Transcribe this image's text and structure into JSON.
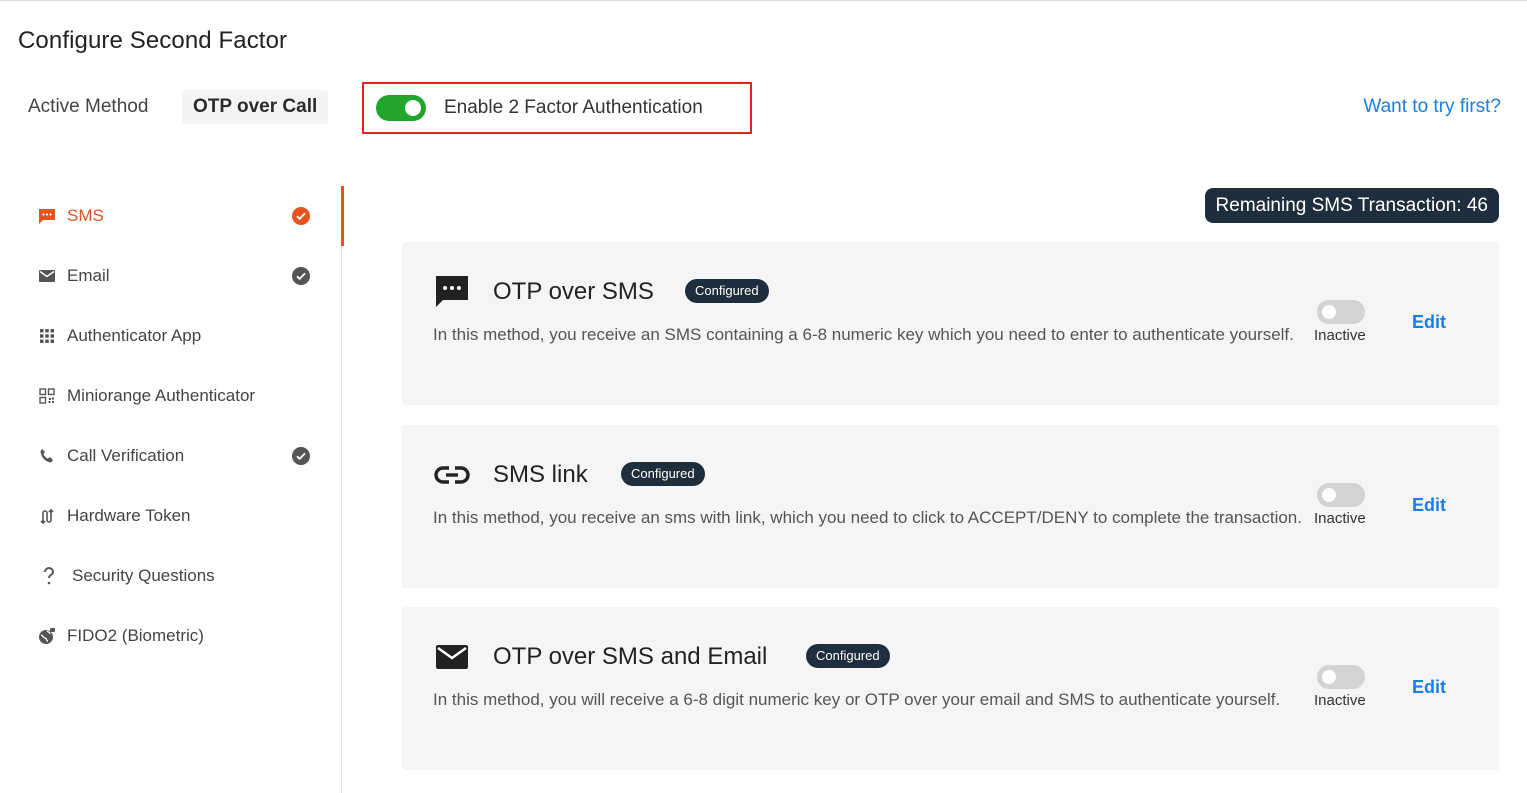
{
  "page": {
    "title": "Configure Second Factor"
  },
  "header": {
    "active_method_label": "Active Method",
    "active_method_value": "OTP over Call",
    "enable_2fa_label": "Enable 2 Factor Authentication",
    "enable_2fa_on": true,
    "try_link": "Want to try first?"
  },
  "colors": {
    "accent": "#e5541f",
    "toggle_on": "#22a52d",
    "link": "#1a7fe0",
    "badge_bg": "#1f2e3d",
    "highlight_border": "#e2231a"
  },
  "sidebar": {
    "items": [
      {
        "label": "SMS",
        "icon": "sms-icon",
        "configured": true,
        "active": true
      },
      {
        "label": "Email",
        "icon": "mail-icon",
        "configured": true,
        "active": false
      },
      {
        "label": "Authenticator App",
        "icon": "grid-icon",
        "configured": false,
        "active": false
      },
      {
        "label": "Miniorange Authenticator",
        "icon": "qr-code-icon",
        "configured": false,
        "active": false
      },
      {
        "label": "Call Verification",
        "icon": "phone-icon",
        "configured": true,
        "active": false
      },
      {
        "label": "Hardware Token",
        "icon": "hardware-token-icon",
        "configured": false,
        "active": false
      },
      {
        "label": "Security Questions",
        "icon": "question-icon",
        "configured": false,
        "active": false
      },
      {
        "label": "FIDO2 (Biometric)",
        "icon": "fingerprint-globe-icon",
        "configured": false,
        "active": false
      }
    ]
  },
  "main": {
    "remaining_sms": "Remaining SMS Transaction: 46",
    "methods": [
      {
        "title": "OTP over SMS",
        "badge": "Configured",
        "icon": "sms-icon",
        "description": "In this method, you receive an SMS containing a 6-8 numeric key which you need to enter to authenticate yourself.",
        "status": "Inactive",
        "edit_label": "Edit"
      },
      {
        "title": "SMS link",
        "badge": "Configured",
        "icon": "link-icon",
        "description": "In this method, you receive an sms with link, which you need to click to ACCEPT/DENY to complete the transaction.",
        "status": "Inactive",
        "edit_label": "Edit"
      },
      {
        "title": "OTP over SMS and Email",
        "badge": "Configured",
        "icon": "mail-icon",
        "description": "In this method, you will receive a 6-8 digit numeric key or OTP over your email and SMS to authenticate yourself.",
        "status": "Inactive",
        "edit_label": "Edit"
      }
    ]
  }
}
